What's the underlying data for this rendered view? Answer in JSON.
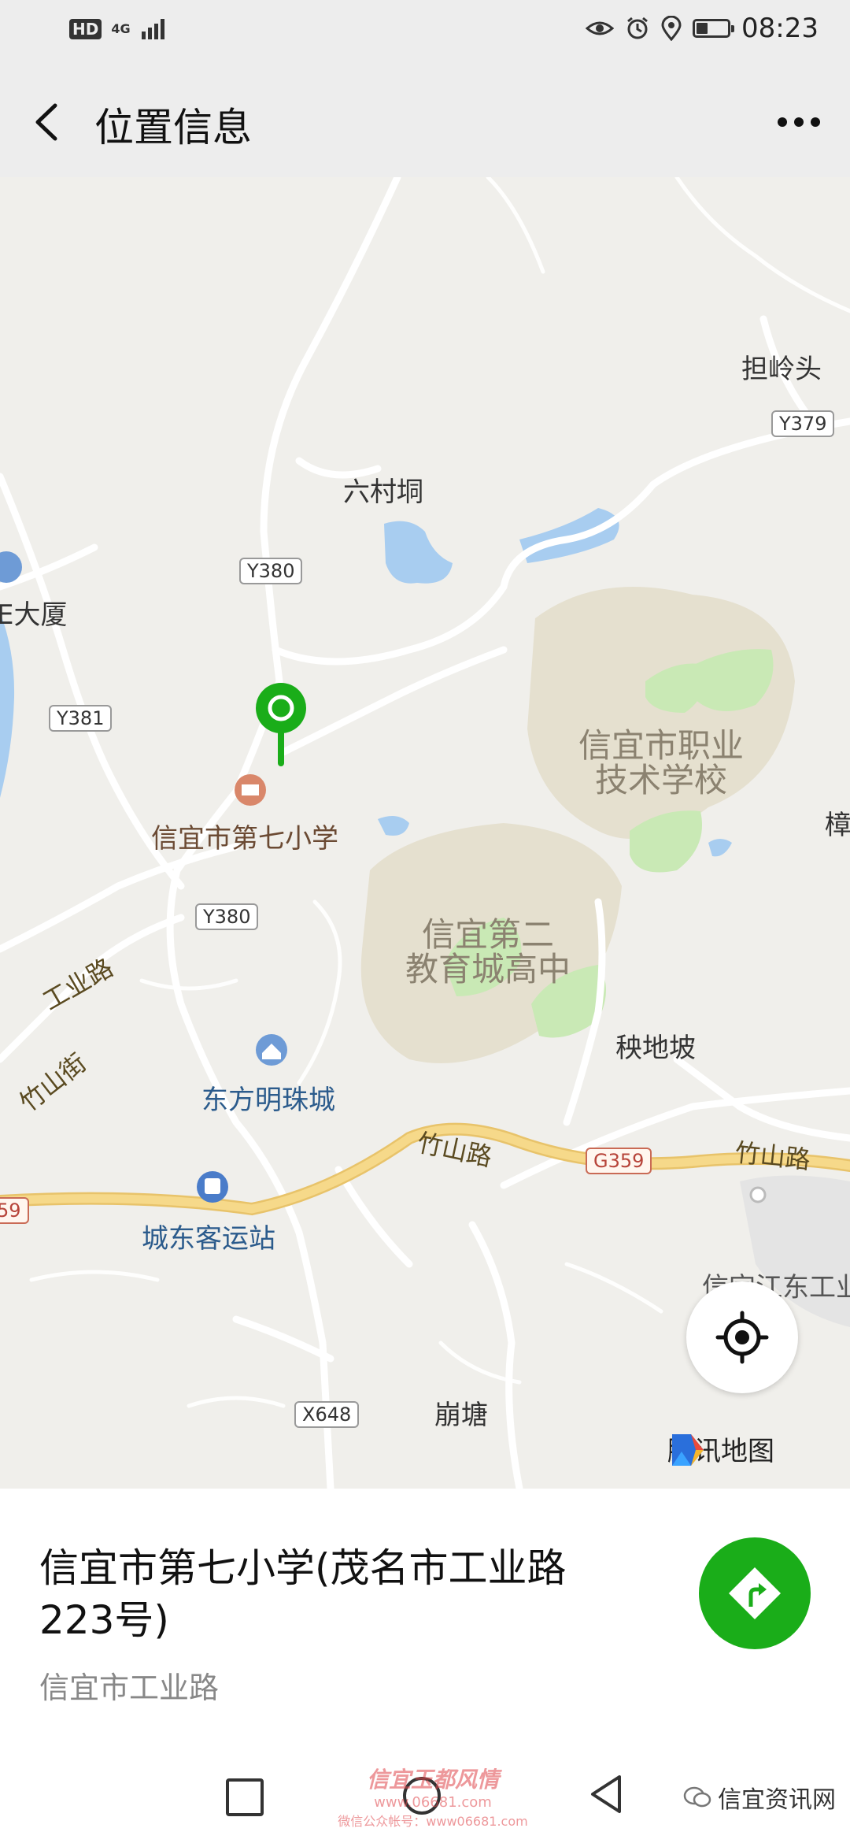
{
  "status_bar": {
    "hd": "HD",
    "network": "4G",
    "time": "08:23"
  },
  "header": {
    "title": "位置信息"
  },
  "map": {
    "labels": {
      "danlingtou": "担岭头",
      "liucuntong": "六村垌",
      "dasha": "E大厦",
      "school7": "信宜市第七小学",
      "vocational": "信宜市职业\n技术学校",
      "second_school": "信宜第二\n教育城高中",
      "yangdipo": "秧地坡",
      "dongfang": "东方明珠城",
      "chengdong": "城东客运站",
      "bengtang": "崩塘",
      "jiangdong": "信宜江东工业",
      "gongye_road": "工业路",
      "zhushan_street": "竹山街",
      "zhushan_road_1": "竹山路",
      "zhushan_road_2": "竹山路",
      "edge_right": "樟",
      "route_59": "59"
    },
    "shields": {
      "y379": "Y379",
      "y380_a": "Y380",
      "y380_b": "Y380",
      "y381": "Y381",
      "g359": "G359",
      "x648": "X648"
    },
    "provider": "腾讯地图",
    "colors": {
      "land": "#f0efeb",
      "water": "#a8cdf0",
      "green": "#c9e9b5",
      "campus": "#e5e0cf",
      "main_road": "#f6d98a",
      "pin": "#1aad19"
    }
  },
  "place": {
    "name": "信宜市第七小学(茂名市工业路223号)",
    "address": "信宜市工业路"
  },
  "watermarks": {
    "center_line1": "信宜玉都风情",
    "center_line2": "www.06681.com",
    "center_line3": "微信公众帐号：www06681.com",
    "right": "信宜资讯网"
  }
}
